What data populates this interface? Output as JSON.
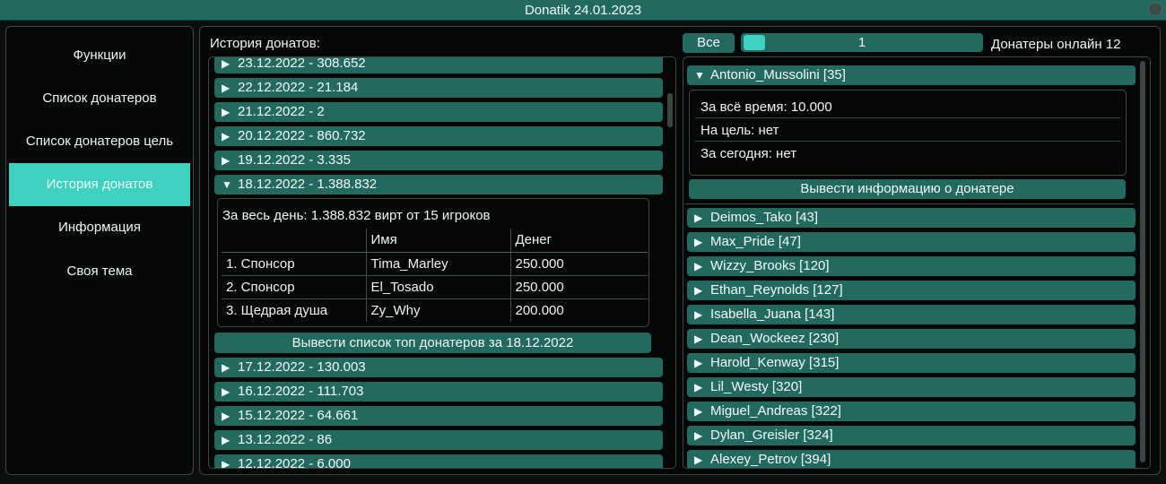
{
  "window": {
    "title": "Donatik 24.01.2023"
  },
  "sidebar": {
    "items": [
      {
        "label": "Функции"
      },
      {
        "label": "Список донатеров"
      },
      {
        "label": "Список донатеров цель"
      },
      {
        "label": "История донатов",
        "active": true
      },
      {
        "label": "Информация"
      },
      {
        "label": "Своя тема"
      }
    ]
  },
  "history": {
    "title": "История донатов:",
    "days_before": [
      "23.12.2022 - 308.652",
      "22.12.2022 - 21.184",
      "21.12.2022 - 2",
      "20.12.2022 - 860.732",
      "19.12.2022 - 3.335"
    ],
    "expanded_day": "18.12.2022 - 1.388.832",
    "summary": "За весь день: 1.388.832 вирт от 15 игроков",
    "table": {
      "headers": [
        "",
        "Имя",
        "Денег"
      ],
      "rows": [
        [
          "1. Спонсор",
          "Tima_Marley",
          "250.000"
        ],
        [
          "2. Спонсор",
          "El_Tosado",
          "250.000"
        ],
        [
          "3. Щедрая душа",
          "Zy_Why",
          "200.000"
        ]
      ]
    },
    "top_button": "Вывести список топ донатеров за 18.12.2022",
    "days_after": [
      "17.12.2022 - 130.003",
      "16.12.2022 - 111.703",
      "15.12.2022 - 64.661",
      "13.12.2022 - 86",
      "12.12.2022 - 6.000"
    ]
  },
  "donors": {
    "all_button": "Все",
    "page_value": "1",
    "online_label": "Донатеры онлайн 12",
    "expanded": "Antonio_Mussolini [35]",
    "details": [
      "За всё время: 10.000",
      "На цель: нет",
      "За сегодня: нет"
    ],
    "info_button": "Вывести информацию о донатере",
    "list": [
      "Deimos_Tako [43]",
      "Max_Pride [47]",
      "Wizzy_Brooks [120]",
      "Ethan_Reynolds [127]",
      "Isabella_Juana [143]",
      "Dean_Wockeez [230]",
      "Harold_Kenway [315]",
      "Lil_Westy [320]",
      "Miguel_Andreas [322]",
      "Dylan_Greisler [324]",
      "Alexey_Petrov [394]"
    ]
  },
  "icons": {
    "collapsed": "triangle-right-icon",
    "expanded": "triangle-down-icon"
  },
  "colors": {
    "accent": "#3fd1bf",
    "row": "#226a5f",
    "background": "#060808"
  }
}
